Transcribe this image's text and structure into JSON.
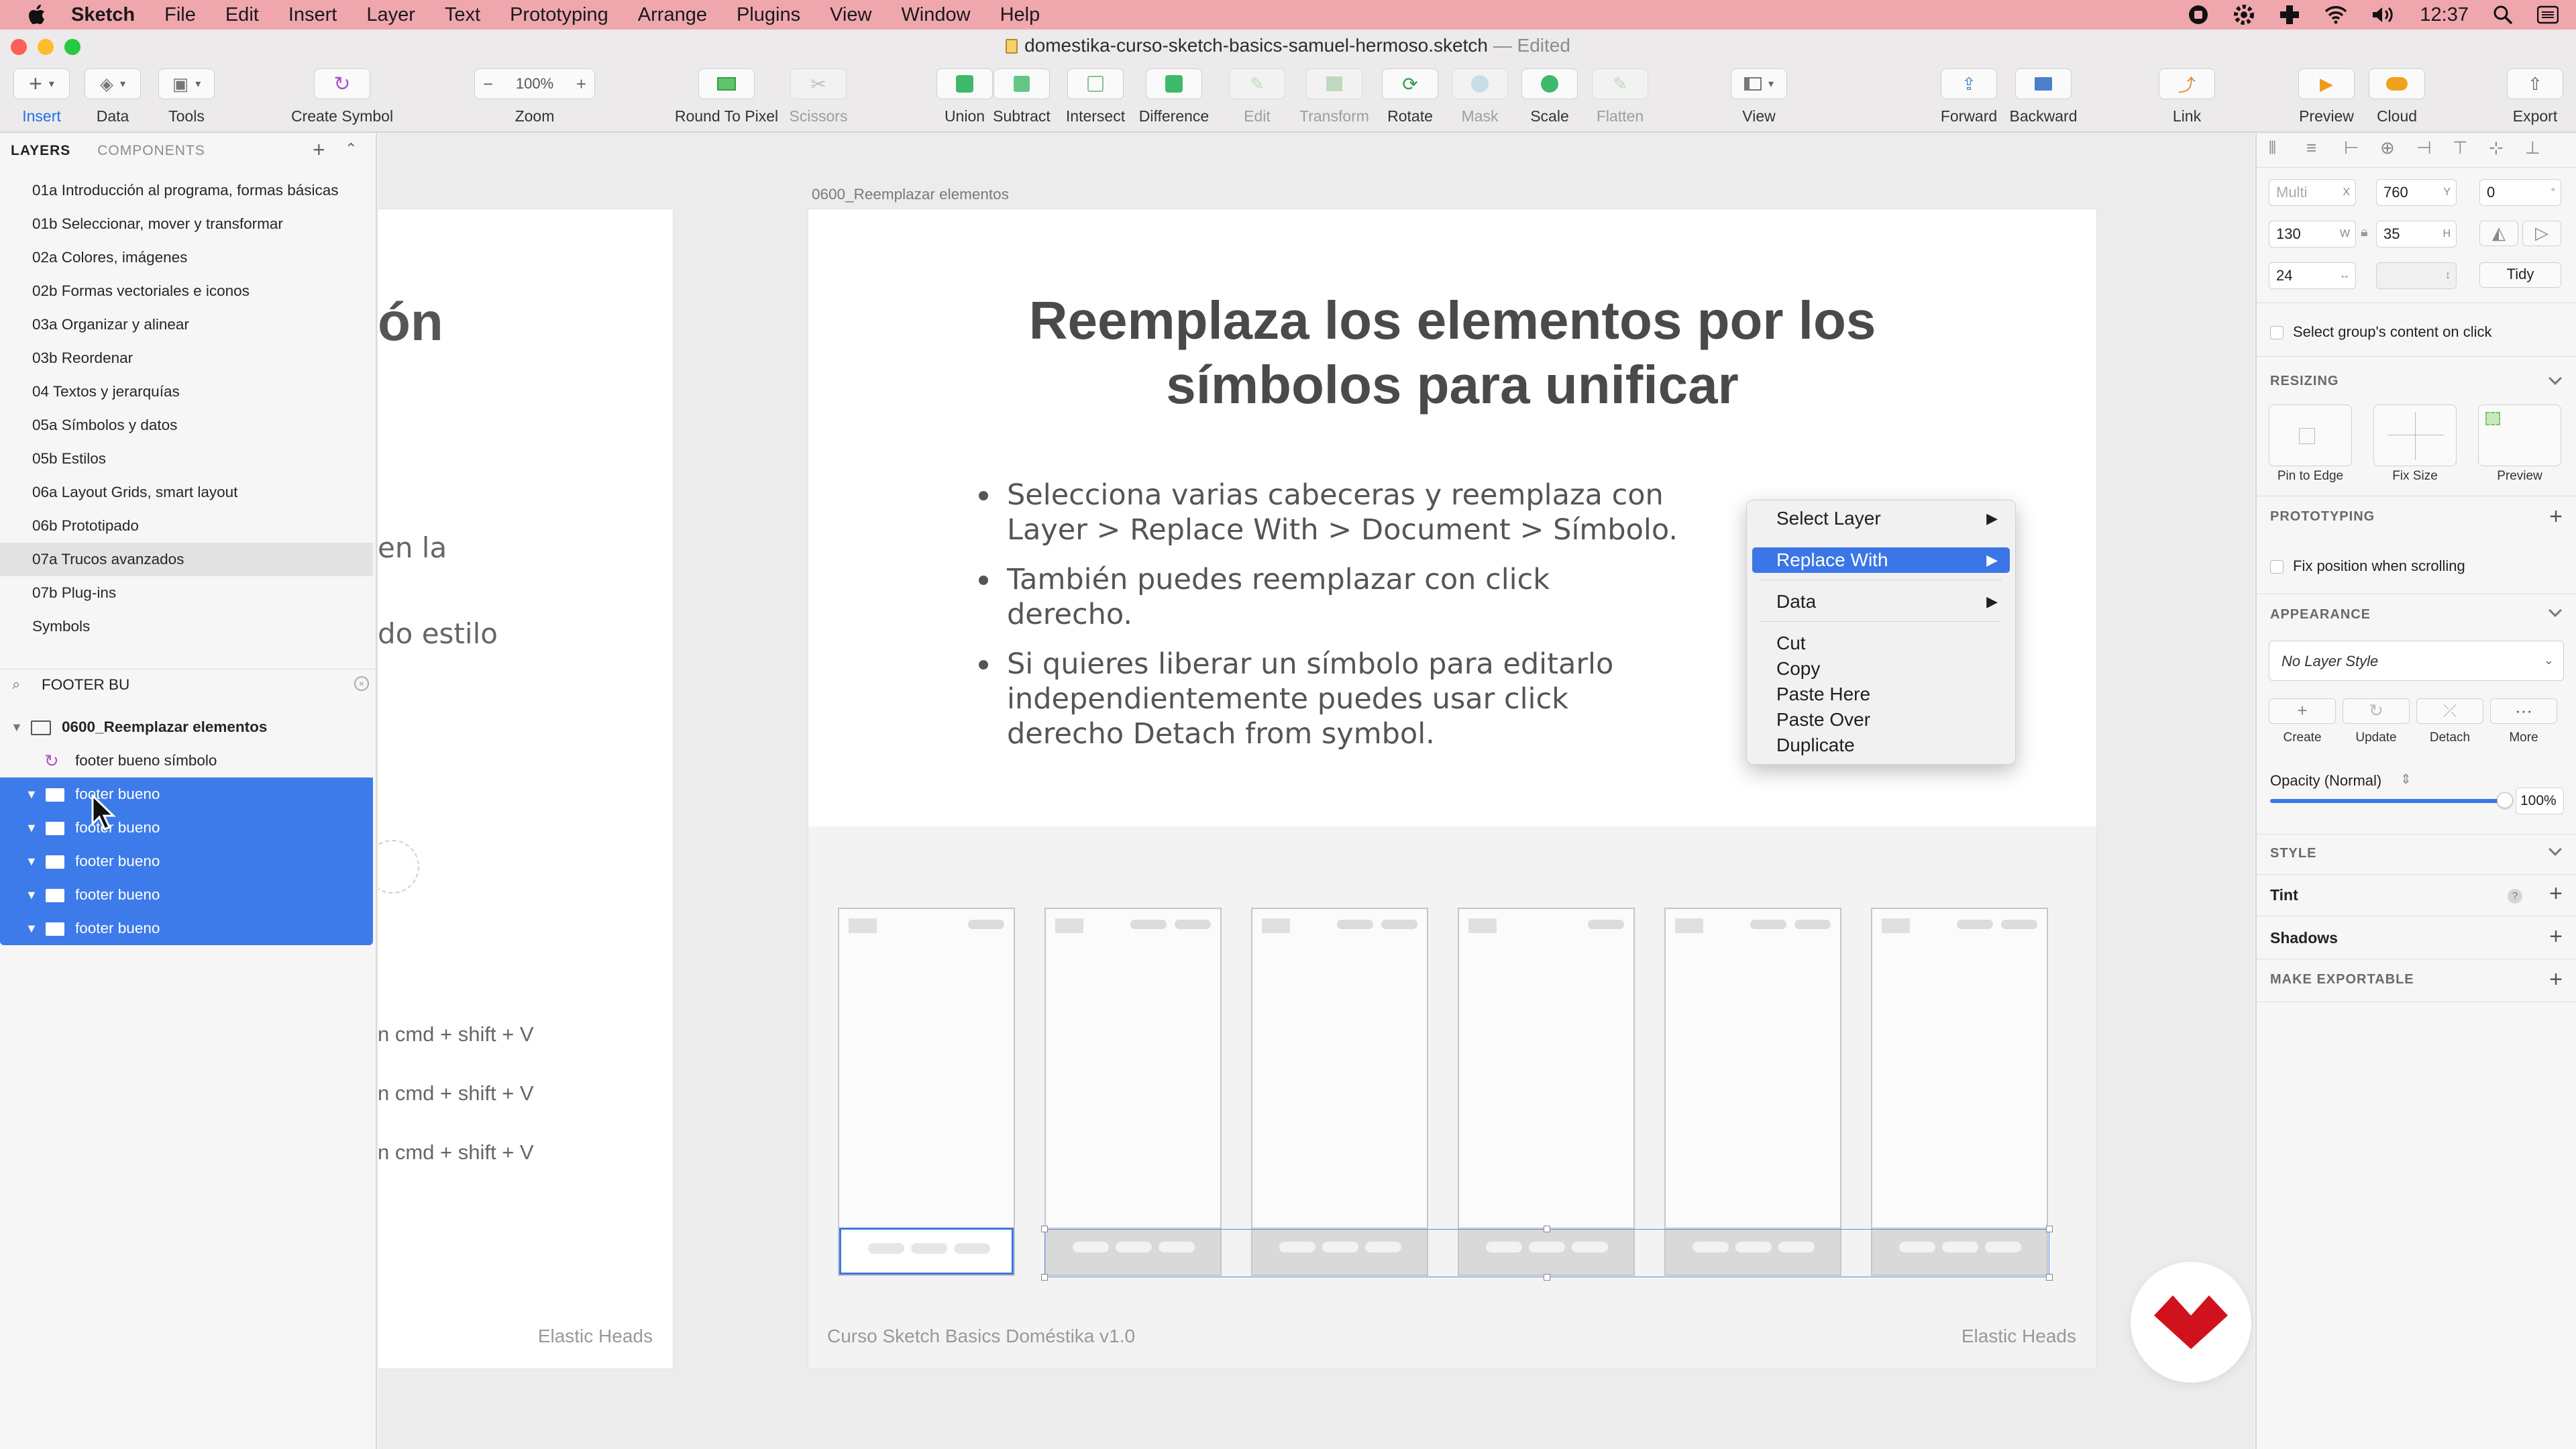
{
  "menubar": {
    "app": "Sketch",
    "items": [
      "File",
      "Edit",
      "Insert",
      "Layer",
      "Text",
      "Prototyping",
      "Arrange",
      "Plugins",
      "View",
      "Window",
      "Help"
    ],
    "clock": "12:37"
  },
  "window": {
    "doc_title": "domestika-curso-sketch-basics-samuel-hermoso.sketch",
    "edited": "— Edited"
  },
  "toolbar": {
    "insert": "Insert",
    "data": "Data",
    "tools": "Tools",
    "create_symbol": "Create Symbol",
    "zoom_label": "Zoom",
    "zoom_value": "100%",
    "round": "Round To Pixel",
    "scissors": "Scissors",
    "union": "Union",
    "subtract": "Subtract",
    "intersect": "Intersect",
    "difference": "Difference",
    "edit": "Edit",
    "transform": "Transform",
    "rotate": "Rotate",
    "mask": "Mask",
    "scale": "Scale",
    "flatten": "Flatten",
    "view": "View",
    "forward": "Forward",
    "backward": "Backward",
    "link": "Link",
    "preview": "Preview",
    "cloud": "Cloud",
    "export": "Export"
  },
  "left": {
    "tab_layers": "LAYERS",
    "tab_components": "COMPONENTS",
    "pages": [
      "01a Introducción al programa, formas básicas",
      "01b Seleccionar, mover y transformar",
      "02a Colores, imágenes",
      "02b Formas vectoriales e iconos",
      "03a Organizar y alinear",
      "03b Reordenar",
      "04 Textos y jerarquías",
      "05a Símbolos y datos",
      "05b Estilos",
      "06a Layout Grids, smart layout",
      "06b Prototipado",
      "07a Trucos avanzados",
      "07b Plug-ins",
      "Symbols"
    ],
    "filter": "FOOTER BU",
    "artboard": "0600_Reemplazar elementos",
    "symbol_layer": "footer bueno símbolo",
    "group_layers": [
      "footer bueno",
      "footer bueno",
      "footer bueno",
      "footer bueno",
      "footer bueno"
    ]
  },
  "canvas": {
    "left_board": {
      "partial_title": "ón",
      "line1": "en la",
      "line2": "do estilo",
      "shortcut1": "n cmd + shift + V",
      "shortcut2": "n cmd + shift + V",
      "shortcut3": "n cmd + shift + V",
      "footer": "Elastic Heads"
    },
    "artboard_label": "0600_Reemplazar elementos",
    "title_line1": "Reemplaza los elementos por los",
    "title_line2": "símbolos para unificar",
    "bullets": [
      [
        "Selecciona varias cabeceras y reemplaza con",
        "Layer > Replace With > Document > Símbolo."
      ],
      [
        "También puedes reemplazar con click",
        "derecho."
      ],
      [
        "Si quieres liberar un símbolo para editarlo",
        "independientemente puedes usar click",
        "derecho Detach from symbol."
      ]
    ],
    "footer_left": "Curso Sketch Basics Doméstika v1.0",
    "footer_right": "Elastic Heads"
  },
  "context_menu": {
    "select_layer": "Select Layer",
    "replace_with": "Replace With",
    "data": "Data",
    "cut": "Cut",
    "copy": "Copy",
    "paste_here": "Paste Here",
    "paste_over": "Paste Over",
    "duplicate": "Duplicate"
  },
  "inspector": {
    "x_placeholder": "Multi",
    "x_suffix": "X",
    "y_value": "760",
    "y_suffix": "Y",
    "rotation": "0",
    "w_value": "130",
    "w_suffix": "W",
    "h_value": "35",
    "h_suffix": "H",
    "spacing": "24",
    "tidy": "Tidy",
    "select_group": "Select group's content on click",
    "resizing": "RESIZING",
    "pin_to_edge": "Pin to Edge",
    "fix_size": "Fix Size",
    "preview": "Preview",
    "prototyping": "PROTOTYPING",
    "fix_position": "Fix position when scrolling",
    "appearance": "APPEARANCE",
    "layer_style": "No Layer Style",
    "create": "Create",
    "update": "Update",
    "detach": "Detach",
    "more": "More",
    "opacity_label": "Opacity (Normal)",
    "opacity_value": "100%",
    "opacity_fraction": 1.0,
    "style": "STYLE",
    "tint": "Tint",
    "shadows": "Shadows",
    "make_exportable": "MAKE EXPORTABLE"
  },
  "colors": {
    "menubar": "#efa7ad",
    "selection": "#3d7bea",
    "brand_logo": "#d0121e"
  }
}
